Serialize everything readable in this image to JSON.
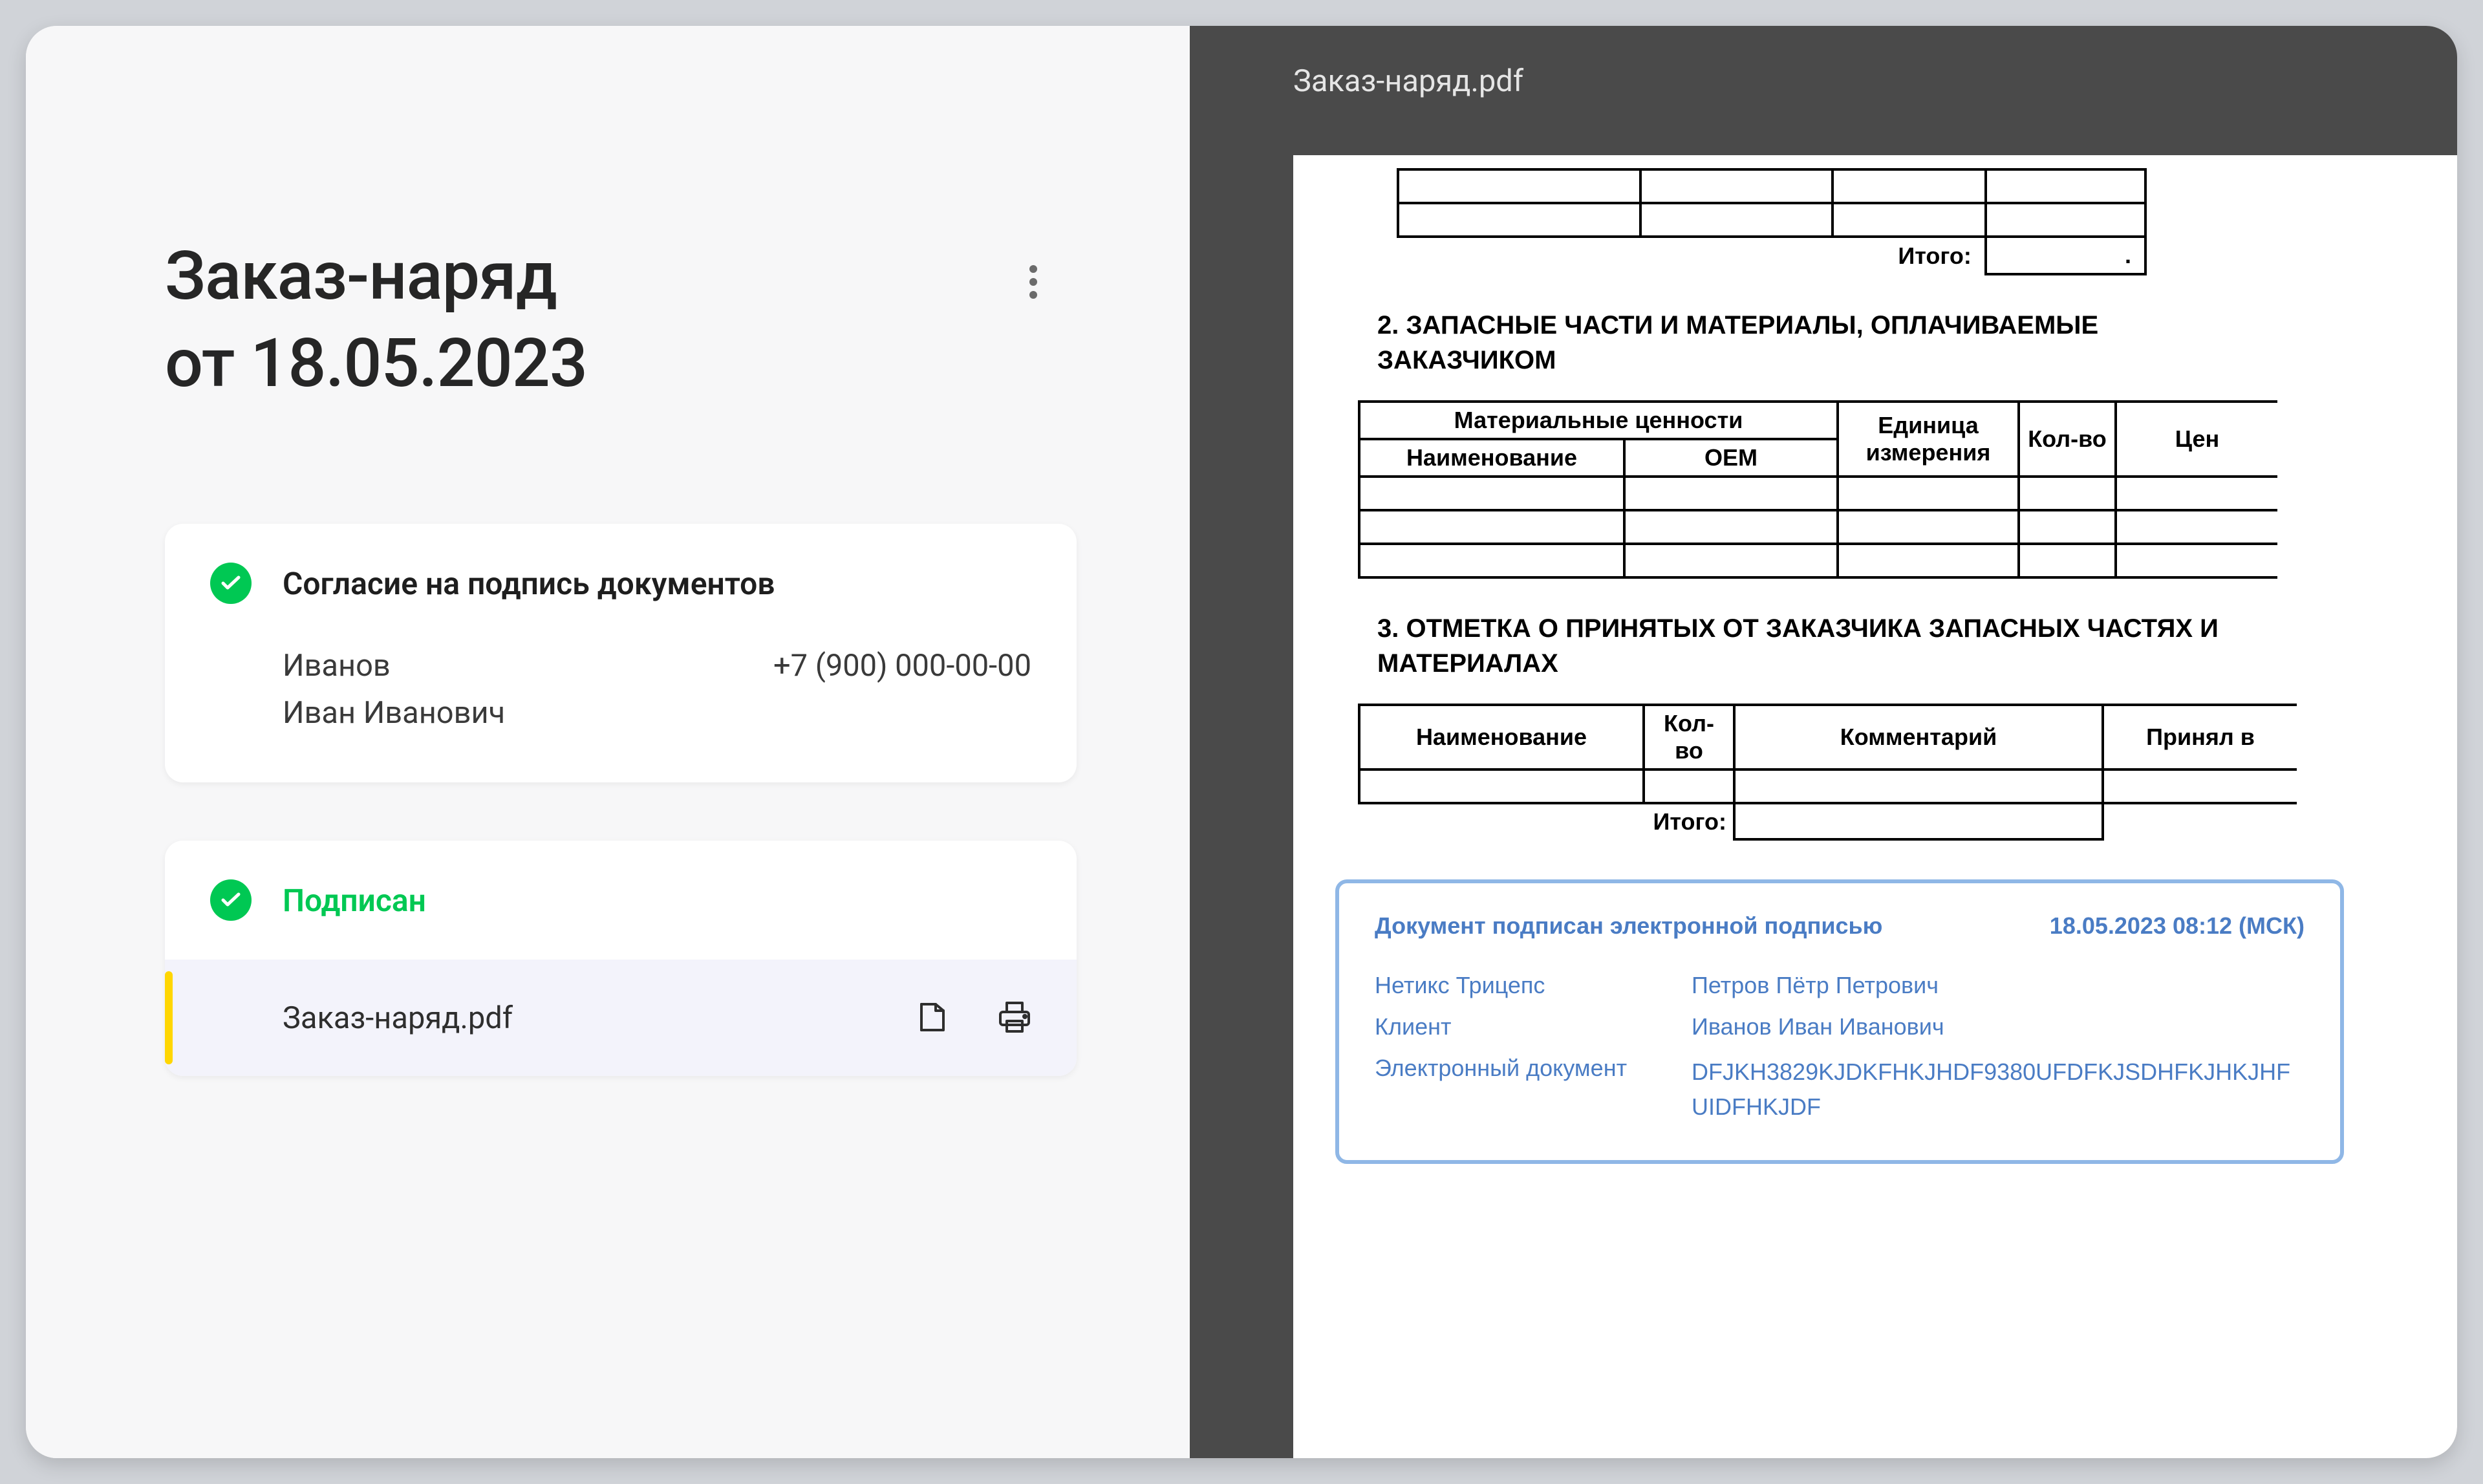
{
  "header": {
    "title_line1": "Заказ-наряд",
    "title_line2": "от 18.05.2023"
  },
  "consent_card": {
    "title": "Согласие на подпись документов",
    "person_line1": "Иванов",
    "person_line2": "Иван Иванович",
    "phone": "+7 (900) 000-00-00"
  },
  "signed_card": {
    "status": "Подписан",
    "file_name": "Заказ-наряд.pdf"
  },
  "preview": {
    "file_name": "Заказ-наряд.pdf",
    "stub_total_label": "Итого:",
    "stub_total_value": ".",
    "section2_title": "2. ЗАПАСНЫЕ ЧАСТИ И МАТЕРИАЛЫ, ОПЛАЧИВАЕМЫЕ ЗАКАЗЧИКОМ",
    "t2_group": "Материальные ценности",
    "t2_h1": "Наименование",
    "t2_h2": "OEM",
    "t2_h3": "Единица измерения",
    "t2_h4": "Кол-во",
    "t2_h5": "Цен",
    "section3_title": "3. ОТМЕТКА О ПРИНЯТЫХ ОТ ЗАКАЗЧИКА ЗАПАСНЫХ ЧАСТЯХ И МАТЕРИАЛАХ",
    "t3_h1": "Наименование",
    "t3_h2": "Кол-во",
    "t3_h3": "Комментарий",
    "t3_h4": "Принял в",
    "t3_total_label": "Итого:",
    "sig_title": "Документ подписан электронной подписью",
    "sig_time": "18.05.2023 08:12 (МСК)",
    "sig_r1_k": "Нетикс Трицепс",
    "sig_r1_v": "Петров Пётр Петрович",
    "sig_r2_k": "Клиент",
    "sig_r2_v": "Иванов Иван Иванович",
    "sig_r3_k": "Электронный документ",
    "sig_r3_v": "DFJKH3829KJDKFHKJHDF9380UFDFKJSDHFKJHKJHF UIDFHKJDF"
  }
}
